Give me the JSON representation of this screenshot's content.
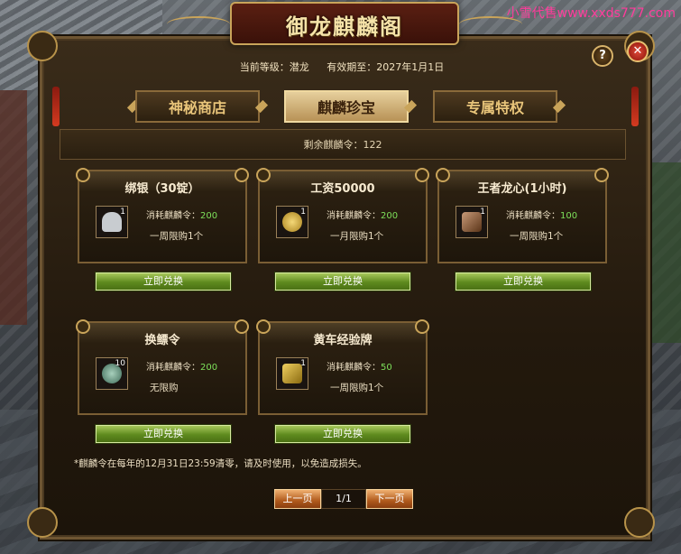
{
  "watermark": "小雪代售www.xxds777.com",
  "window": {
    "title": "御龙麒麟阁",
    "help_label": "?",
    "close_label": "✕"
  },
  "header": {
    "level_label": "当前等级：潜龙",
    "expiry_label": "有效期至：2027年1月1日"
  },
  "tabs": [
    {
      "label": "神秘商店",
      "active": false
    },
    {
      "label": "麒麟珍宝",
      "active": true
    },
    {
      "label": "专属特权",
      "active": false
    }
  ],
  "remaining": "剩余麒麟令：122",
  "cost_prefix": "消耗麒麟令：",
  "items": [
    {
      "name": "绑银（30锭）",
      "count": "1",
      "cost": "200",
      "limit": "一周限购1个",
      "button": "立即兑换",
      "icon": "silver-ingot-icon",
      "icon_color": "#c8ccd0"
    },
    {
      "name": "工资50000",
      "count": "1",
      "cost": "200",
      "limit": "一月限购1个",
      "button": "立即兑换",
      "icon": "gold-coins-icon",
      "icon_color": "#d8b040"
    },
    {
      "name": "王者龙心(1小时)",
      "count": "1",
      "cost": "100",
      "limit": "一周限购1个",
      "button": "立即兑换",
      "icon": "dragon-heart-icon",
      "icon_color": "#9a6a48"
    },
    {
      "name": "换鳔令",
      "count": "10",
      "cost": "200",
      "limit": "无限购",
      "button": "立即兑换",
      "icon": "token-icon",
      "icon_color": "#6a9a86"
    },
    {
      "name": "黄车经验牌",
      "count": "1",
      "cost": "50",
      "limit": "一周限购1个",
      "button": "立即兑换",
      "icon": "gold-cart-icon",
      "icon_color": "#c89a28"
    }
  ],
  "note": "*麒麟令在每年的12月31日23:59清零，请及时使用，以免造成损失。",
  "pager": {
    "prev_label": "上一页",
    "page_indicator": "1/1",
    "next_label": "下一页"
  }
}
